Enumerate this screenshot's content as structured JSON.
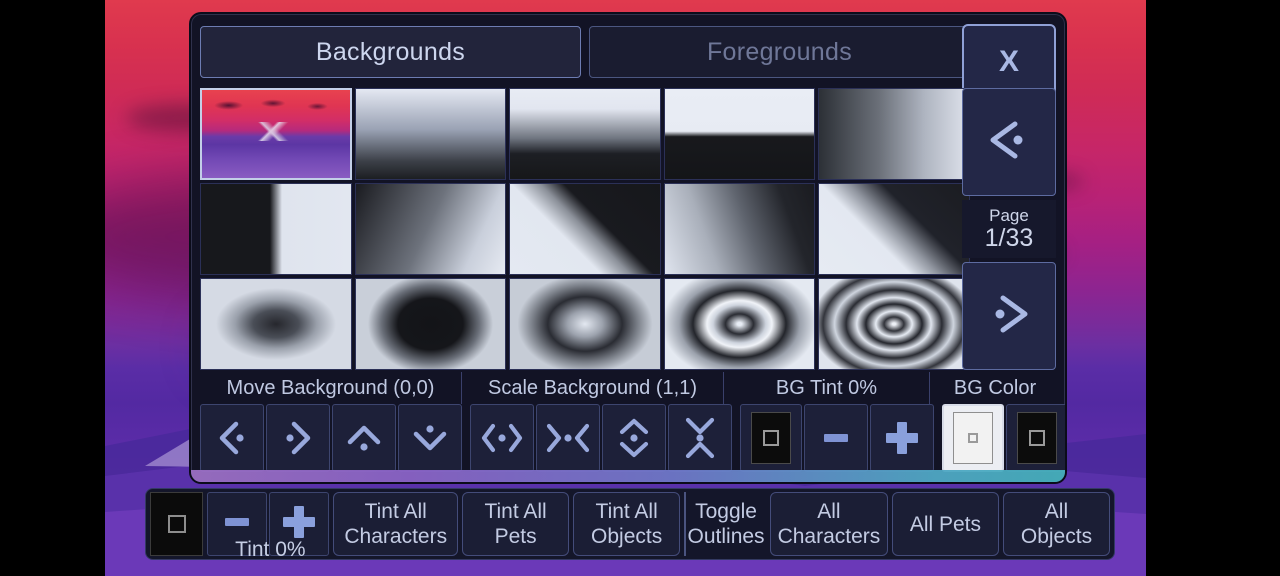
{
  "tabs": [
    {
      "label": "Backgrounds",
      "state": "active"
    },
    {
      "label": "Foregrounds",
      "state": "inactive"
    }
  ],
  "close_button": {
    "label": "X",
    "icon": "close-icon"
  },
  "pager": {
    "prev_icon": "chevron-left-dot-icon",
    "next_icon": "chevron-right-dot-icon",
    "page_word": "Page",
    "page_value": "1/33"
  },
  "grid": {
    "rows": 3,
    "columns": 5,
    "selected_index": 0,
    "thumbnails": [
      {
        "name": "background-scene-sunset-mountains",
        "art": "t-scene",
        "selected": true
      },
      {
        "name": "background-gradient-vertical-soft",
        "art": "t-g1",
        "selected": false
      },
      {
        "name": "background-gradient-vertical-mid",
        "art": "t-g2",
        "selected": false
      },
      {
        "name": "background-gradient-horizon-hard",
        "art": "t-g3",
        "selected": false
      },
      {
        "name": "background-gradient-horizontal",
        "art": "t-g4",
        "selected": false
      },
      {
        "name": "background-split-vertical",
        "art": "t-g5",
        "selected": false
      },
      {
        "name": "background-gradient-diagonal-soft",
        "art": "t-g6",
        "selected": false
      },
      {
        "name": "background-diagonal-wedge-up",
        "art": "t-g7",
        "selected": false
      },
      {
        "name": "background-gradient-diagonal-wide",
        "art": "t-g8",
        "selected": false
      },
      {
        "name": "background-diagonal-wedge-down",
        "art": "t-g9",
        "selected": false
      },
      {
        "name": "background-radial-dark-center",
        "art": "t-r1",
        "selected": false
      },
      {
        "name": "background-radial-ellipse-dark",
        "art": "t-r2",
        "selected": false
      },
      {
        "name": "background-radial-light-center",
        "art": "t-r3",
        "selected": false
      },
      {
        "name": "background-radial-rings-two",
        "art": "t-r4",
        "selected": false
      },
      {
        "name": "background-radial-rings-three",
        "art": "t-r5",
        "selected": false
      }
    ]
  },
  "controls": {
    "move_label": "Move Background (0,0)",
    "scale_label": "Scale Background (1,1)",
    "tint_label": "BG Tint 0%",
    "color_label": "BG Color",
    "move_buttons": [
      {
        "name": "move-left-button",
        "icon": "chevron-left-dot-icon"
      },
      {
        "name": "move-right-button",
        "icon": "chevron-right-dot-icon"
      },
      {
        "name": "move-up-button",
        "icon": "chevron-up-dot-icon"
      },
      {
        "name": "move-down-button",
        "icon": "chevron-down-dot-icon"
      }
    ],
    "scale_buttons": [
      {
        "name": "scale-wider-button",
        "icon": "expand-horizontal-icon"
      },
      {
        "name": "scale-narrower-button",
        "icon": "collapse-horizontal-icon"
      },
      {
        "name": "scale-taller-button",
        "icon": "expand-vertical-icon"
      },
      {
        "name": "scale-shorter-button",
        "icon": "collapse-vertical-icon"
      }
    ],
    "tint_swatch": {
      "name": "bg-tint-swatch",
      "color": "#0c0c0c"
    },
    "tint_minus": {
      "name": "bg-tint-decrease-button",
      "icon": "minus-icon"
    },
    "tint_plus": {
      "name": "bg-tint-increase-button",
      "icon": "plus-icon"
    },
    "color_swatches": [
      {
        "name": "bg-color-white-swatch",
        "color": "#f2f2f2",
        "selected": true
      },
      {
        "name": "bg-color-black-swatch",
        "color": "#0c0c0c",
        "selected": false
      }
    ]
  },
  "bottom_bar": {
    "tint_swatch": {
      "name": "tint-swatch",
      "color": "#0b0b0b"
    },
    "tint_minus": {
      "name": "tint-decrease-button",
      "icon": "minus-icon"
    },
    "tint_plus": {
      "name": "tint-increase-button",
      "icon": "plus-icon"
    },
    "tint_percent": "Tint 0%",
    "buttons": [
      {
        "name": "tint-all-characters-button",
        "label": "Tint All\nCharacters",
        "line1": "Tint All",
        "line2": "Characters"
      },
      {
        "name": "tint-all-pets-button",
        "label": "Tint All\nPets",
        "line1": "Tint All",
        "line2": "Pets"
      },
      {
        "name": "tint-all-objects-button",
        "label": "Tint All\nObjects",
        "line1": "Tint All",
        "line2": "Objects"
      }
    ],
    "toggle_outlines": {
      "line1": "Toggle",
      "line2": "Outlines"
    },
    "right_buttons": [
      {
        "name": "all-characters-button",
        "line1": "All",
        "line2": "Characters"
      },
      {
        "name": "all-pets-button",
        "line1": "All Pets",
        "line2": ""
      },
      {
        "name": "all-objects-button",
        "line1": "All",
        "line2": "Objects"
      }
    ]
  },
  "theme": {
    "panel_bg": "#121325",
    "accent_blue": "#a9b8e4",
    "text_light": "#c3cbe3",
    "wallpaper_sky": "#d8314f",
    "wallpaper_ground": "#5a2da6"
  }
}
